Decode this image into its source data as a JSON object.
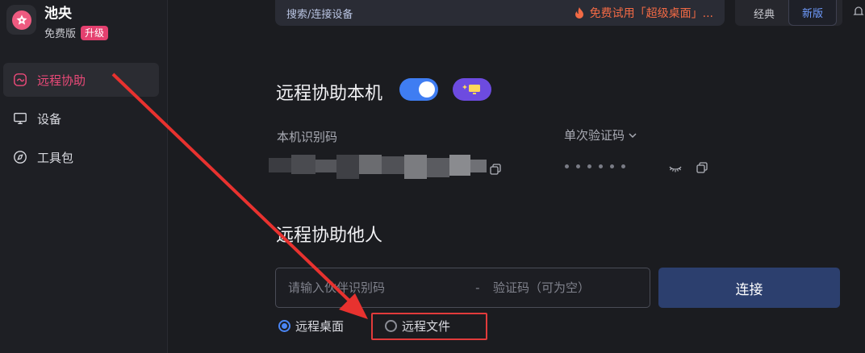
{
  "brand": {
    "name": "池央",
    "plan": "免费版",
    "upgrade_label": "升级"
  },
  "sidebar": {
    "items": [
      {
        "label": "远程协助",
        "icon": "remote-assist-icon",
        "active": true
      },
      {
        "label": "设备",
        "icon": "device-icon",
        "active": false
      },
      {
        "label": "工具包",
        "icon": "compass-icon",
        "active": false
      }
    ]
  },
  "topbar": {
    "search_placeholder": "搜索/连接设备",
    "promo_text": "免费试用「超级桌面」...",
    "mode_classic": "经典",
    "mode_new": "新版"
  },
  "assist_self": {
    "title": "远程协助本机",
    "toggle_on": true,
    "id_label": "本机识别码",
    "code_label": "单次验证码",
    "code_dots": 6
  },
  "assist_other": {
    "title": "远程协助他人",
    "id_placeholder": "请输入伙伴识别码",
    "separator": "-",
    "code_placeholder": "验证码（可为空）",
    "connect_label": "连接",
    "options": [
      {
        "label": "远程桌面",
        "selected": true
      },
      {
        "label": "远程文件",
        "selected": false
      }
    ]
  },
  "colors": {
    "accent_pink": "#ec4a79",
    "accent_blue": "#3f7df2",
    "annotation_red": "#e23b3b"
  }
}
